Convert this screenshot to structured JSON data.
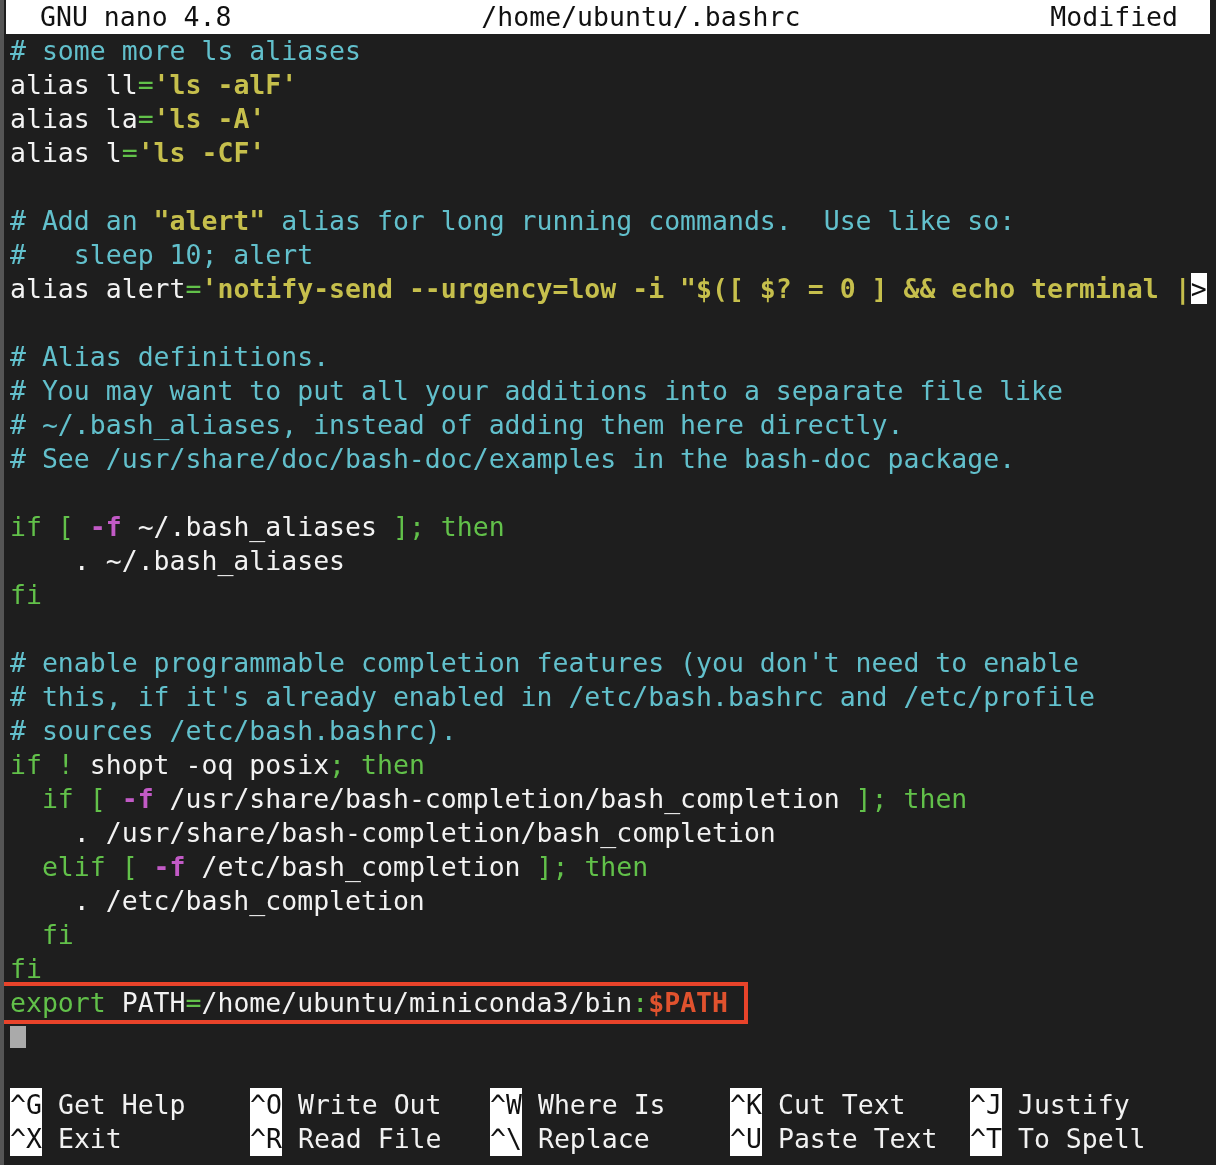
{
  "title_bar": {
    "app": "GNU nano 4.8",
    "file": "/home/ubuntu/.bashrc",
    "status": "Modified"
  },
  "lines": [
    {
      "kind": "code",
      "segments": [
        {
          "text": "# some more ls aliases",
          "kind": "comment"
        }
      ]
    },
    {
      "kind": "code",
      "segments": [
        {
          "text": "alias ll",
          "kind": "plain"
        },
        {
          "text": "=",
          "kind": "keyword"
        },
        {
          "text": "'ls -alF'",
          "kind": "string"
        }
      ]
    },
    {
      "kind": "code",
      "segments": [
        {
          "text": "alias la",
          "kind": "plain"
        },
        {
          "text": "=",
          "kind": "keyword"
        },
        {
          "text": "'ls -A'",
          "kind": "string"
        }
      ]
    },
    {
      "kind": "code",
      "segments": [
        {
          "text": "alias l",
          "kind": "plain"
        },
        {
          "text": "=",
          "kind": "keyword"
        },
        {
          "text": "'ls -CF'",
          "kind": "string"
        }
      ]
    },
    {
      "kind": "blank"
    },
    {
      "kind": "code",
      "segments": [
        {
          "text": "# Add an ",
          "kind": "comment"
        },
        {
          "text": "\"alert\"",
          "kind": "string"
        },
        {
          "text": " alias for long running commands.  Use like so:",
          "kind": "comment"
        }
      ]
    },
    {
      "kind": "code",
      "segments": [
        {
          "text": "#   sleep 10; alert",
          "kind": "comment"
        }
      ]
    },
    {
      "kind": "code",
      "segments": [
        {
          "text": "alias alert",
          "kind": "plain"
        },
        {
          "text": "=",
          "kind": "keyword"
        },
        {
          "text": "'notify-send --urgency=low -i \"$([ $? = 0 ] && echo terminal |",
          "kind": "string"
        },
        {
          "text": ">",
          "kind": "overflow"
        }
      ]
    },
    {
      "kind": "blank"
    },
    {
      "kind": "code",
      "segments": [
        {
          "text": "# Alias definitions.",
          "kind": "comment"
        }
      ]
    },
    {
      "kind": "code",
      "segments": [
        {
          "text": "# You may want to put all your additions into a separate file like",
          "kind": "comment"
        }
      ]
    },
    {
      "kind": "code",
      "segments": [
        {
          "text": "# ~/.bash_aliases, instead of adding them here directly.",
          "kind": "comment"
        }
      ]
    },
    {
      "kind": "code",
      "segments": [
        {
          "text": "# See /usr/share/doc/bash-doc/examples in the bash-doc package.",
          "kind": "comment"
        }
      ]
    },
    {
      "kind": "blank"
    },
    {
      "kind": "code",
      "segments": [
        {
          "text": "if [ ",
          "kind": "keyword"
        },
        {
          "text": "-f",
          "kind": "flag"
        },
        {
          "text": " ~/.bash_aliases ",
          "kind": "plain"
        },
        {
          "text": "]; then",
          "kind": "keyword"
        }
      ]
    },
    {
      "kind": "code",
      "segments": [
        {
          "text": "    . ~/.bash_aliases",
          "kind": "plain"
        }
      ]
    },
    {
      "kind": "code",
      "segments": [
        {
          "text": "fi",
          "kind": "keyword"
        }
      ]
    },
    {
      "kind": "blank"
    },
    {
      "kind": "code",
      "segments": [
        {
          "text": "# enable programmable completion features (you don't need to enable",
          "kind": "comment"
        }
      ]
    },
    {
      "kind": "code",
      "segments": [
        {
          "text": "# this, if it's already enabled in /etc/bash.bashrc and /etc/profile",
          "kind": "comment"
        }
      ]
    },
    {
      "kind": "code",
      "segments": [
        {
          "text": "# sources /etc/bash.bashrc).",
          "kind": "comment"
        }
      ]
    },
    {
      "kind": "code",
      "segments": [
        {
          "text": "if ! ",
          "kind": "keyword"
        },
        {
          "text": "shopt -oq posix",
          "kind": "plain"
        },
        {
          "text": "; then",
          "kind": "keyword"
        }
      ]
    },
    {
      "kind": "code",
      "segments": [
        {
          "text": "  if [ ",
          "kind": "keyword"
        },
        {
          "text": "-f",
          "kind": "flag"
        },
        {
          "text": " /usr/share/bash-completion/bash_completion ",
          "kind": "plain"
        },
        {
          "text": "]; then",
          "kind": "keyword"
        }
      ]
    },
    {
      "kind": "code",
      "segments": [
        {
          "text": "    . /usr/share/bash-completion/bash_completion",
          "kind": "plain"
        }
      ]
    },
    {
      "kind": "code",
      "segments": [
        {
          "text": "  elif [ ",
          "kind": "keyword"
        },
        {
          "text": "-f",
          "kind": "flag"
        },
        {
          "text": " /etc/bash_completion ",
          "kind": "plain"
        },
        {
          "text": "]; then",
          "kind": "keyword"
        }
      ]
    },
    {
      "kind": "code",
      "segments": [
        {
          "text": "    . /etc/bash_completion",
          "kind": "plain"
        }
      ]
    },
    {
      "kind": "code",
      "segments": [
        {
          "text": "  fi",
          "kind": "keyword"
        }
      ]
    },
    {
      "kind": "code",
      "segments": [
        {
          "text": "fi",
          "kind": "keyword"
        }
      ]
    },
    {
      "kind": "code",
      "highlighted": true,
      "segments": [
        {
          "text": "export",
          "kind": "keyword"
        },
        {
          "text": " PATH",
          "kind": "plain"
        },
        {
          "text": "=",
          "kind": "keyword"
        },
        {
          "text": "/home/ubuntu/miniconda3/bin",
          "kind": "plain"
        },
        {
          "text": ":",
          "kind": "keyword"
        },
        {
          "text": "$PATH",
          "kind": "variable"
        }
      ]
    },
    {
      "kind": "cursor"
    }
  ],
  "shortcuts": [
    {
      "key": "^G",
      "label": "Get Help"
    },
    {
      "key": "^O",
      "label": "Write Out"
    },
    {
      "key": "^W",
      "label": "Where Is"
    },
    {
      "key": "^K",
      "label": "Cut Text"
    },
    {
      "key": "^J",
      "label": "Justify"
    },
    {
      "key": "^X",
      "label": "Exit"
    },
    {
      "key": "^R",
      "label": "Read File"
    },
    {
      "key": "^\\",
      "label": "Replace"
    },
    {
      "key": "^U",
      "label": "Paste Text"
    },
    {
      "key": "^T",
      "label": "To Spell"
    }
  ]
}
